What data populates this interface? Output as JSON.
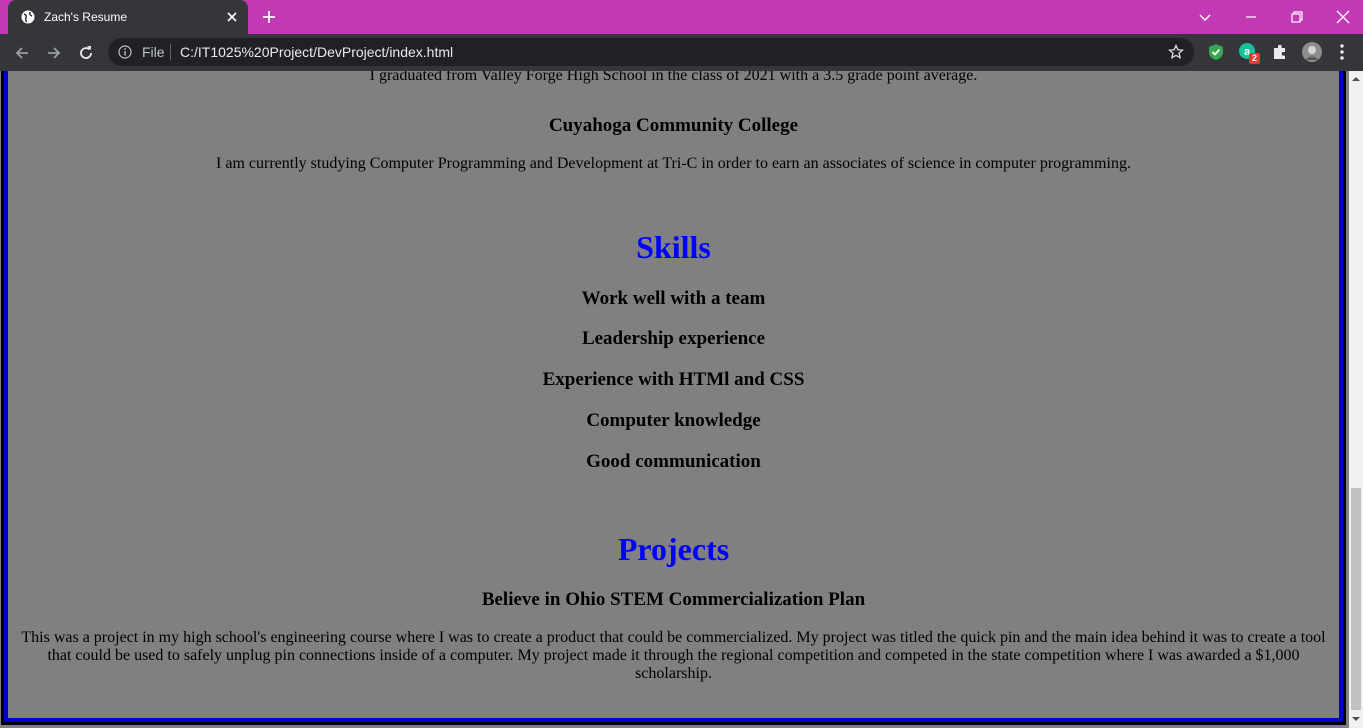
{
  "browser": {
    "tab_title": "Zach's Resume",
    "omnibox": {
      "scheme_label": "File",
      "url": "C:/IT1025%20Project/DevProject/index.html"
    },
    "extension_badge": "2",
    "colors": {
      "tabbar": "#c239b3",
      "toolbar": "#35363a"
    }
  },
  "page": {
    "clipped_text": "I graduated from Valley Forge High School in the class of 2021 with a 3.5 grade point average.",
    "education": {
      "school": "Cuyahoga Community College",
      "description": "I am currently studying Computer Programming and Development at Tri-C in order to earn an associates of science in computer programming."
    },
    "skills": {
      "heading": "Skills",
      "items": [
        "Work well with a team",
        "Leadership experience",
        "Experience with HTMl and CSS",
        "Computer knowledge",
        "Good communication"
      ]
    },
    "projects": {
      "heading": "Projects",
      "title": "Believe in Ohio STEM Commercialization Plan",
      "description": "This was a project in my high school's engineering course where I was to create a product that could be commercialized. My project was titled the quick pin and the main idea behind it was to create a tool that could be used to safely unplug pin connections inside of a computer. My project made it through the regional competition and competed in the state competition where I was awarded a $1,000 scholarship."
    },
    "colors": {
      "background": "#808080",
      "heading": "#0000ff",
      "border": "#0000c8"
    }
  }
}
